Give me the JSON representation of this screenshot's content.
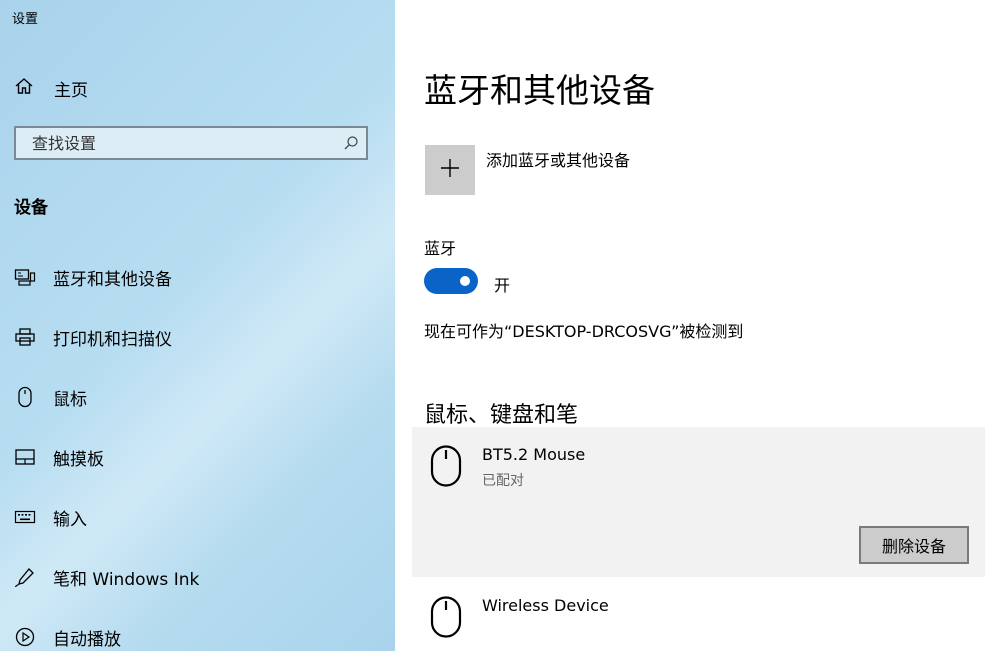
{
  "window": {
    "title": "设置"
  },
  "sidebar": {
    "home_label": "主页",
    "search_placeholder": "查找设置",
    "section_title": "设备",
    "items": [
      {
        "label": "蓝牙和其他设备",
        "icon": "bluetooth-devices-icon"
      },
      {
        "label": "打印机和扫描仪",
        "icon": "printer-icon"
      },
      {
        "label": "鼠标",
        "icon": "mouse-icon"
      },
      {
        "label": "触摸板",
        "icon": "touchpad-icon"
      },
      {
        "label": "输入",
        "icon": "keyboard-icon"
      },
      {
        "label": "笔和 Windows Ink",
        "icon": "pen-icon"
      },
      {
        "label": "自动播放",
        "icon": "autoplay-icon"
      }
    ]
  },
  "main": {
    "title": "蓝牙和其他设备",
    "add_device_label": "添加蓝牙或其他设备",
    "bluetooth_label": "蓝牙",
    "bluetooth_state": "开",
    "bluetooth_on": true,
    "discoverable_text": "现在可作为“DESKTOP-DRCOSVG”被检测到",
    "group_title": "鼠标、键盘和笔",
    "devices": [
      {
        "name": "BT5.2 Mouse",
        "status": "已配对",
        "icon": "mouse-icon",
        "action": "删除设备",
        "selected": true
      },
      {
        "name": "Wireless Device",
        "status": "",
        "icon": "mouse-icon",
        "selected": false
      }
    ]
  },
  "colors": {
    "accent": "#0a64c8",
    "sidebar_bg": "#b3dbef",
    "selected_card": "#f2f2f2"
  }
}
